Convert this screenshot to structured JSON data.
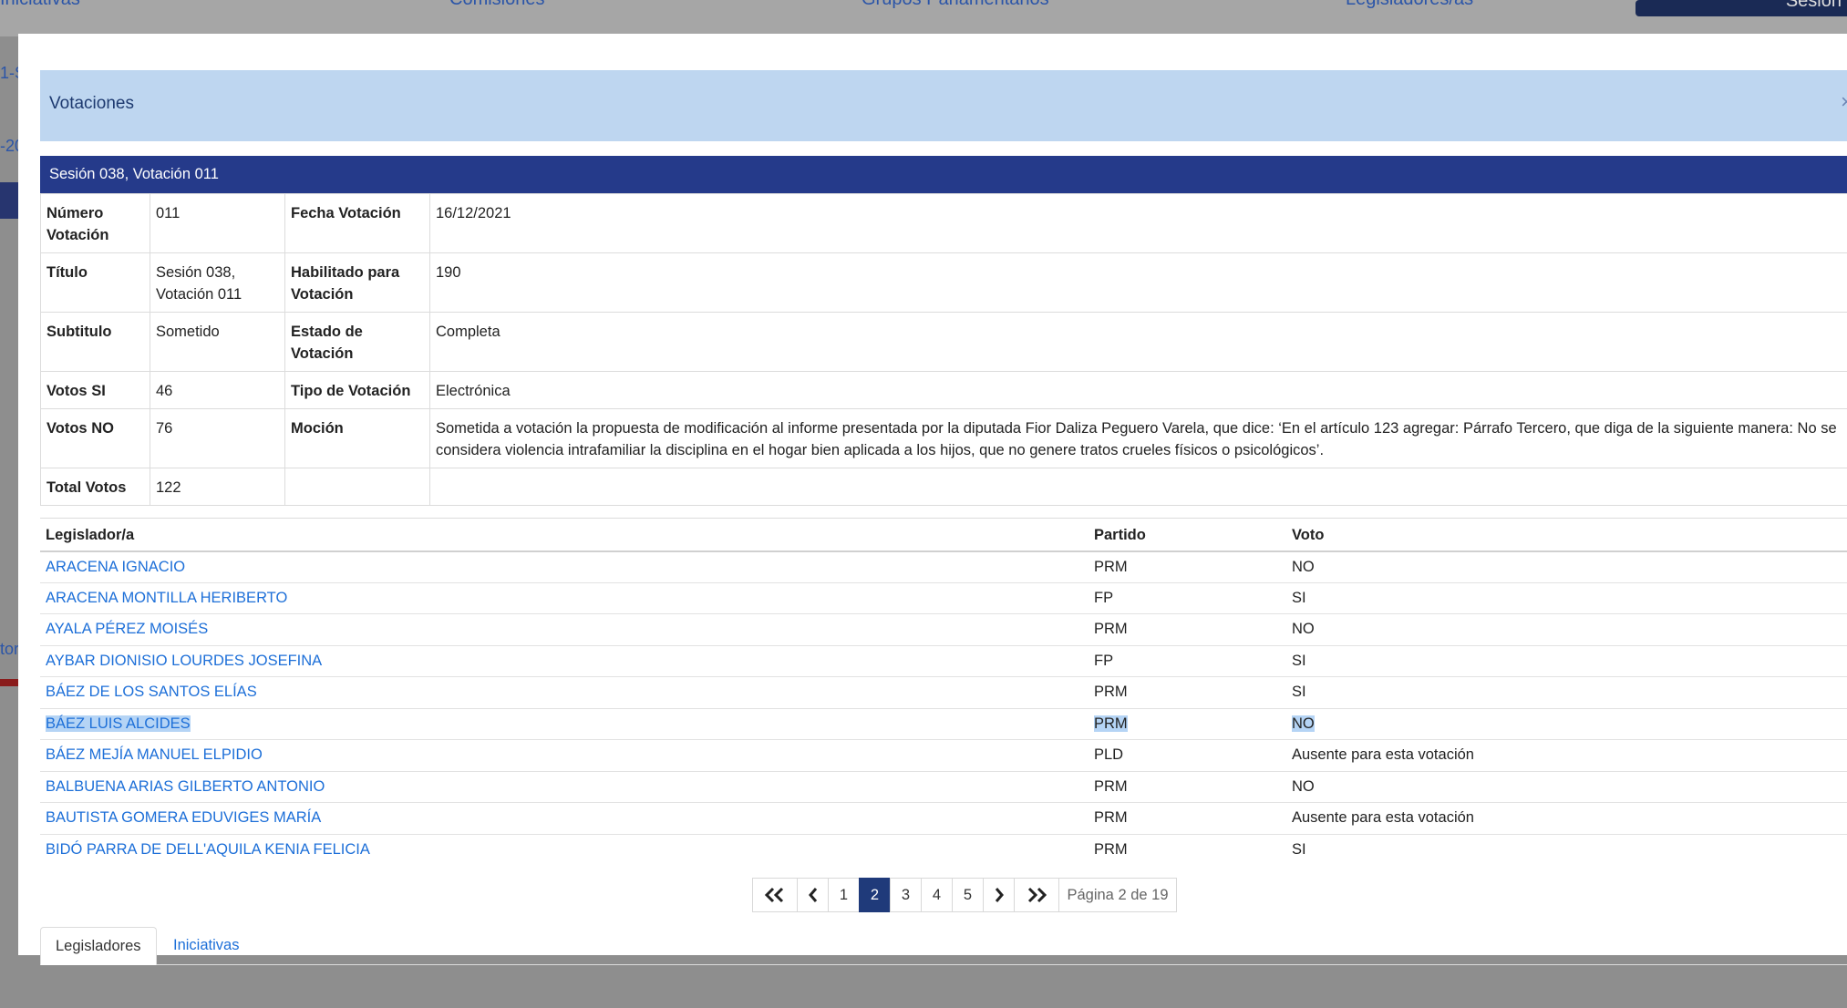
{
  "background": {
    "nav": [
      "Iniciativas",
      "Comisiones",
      "Grupos Parlamentarios",
      "Legisladores/as"
    ],
    "button": "Sesión",
    "left_fragments": [
      "1-S",
      "-20",
      "tori"
    ]
  },
  "modal": {
    "title": "Votaciones",
    "close": "×",
    "session_header": "Sesión 038, Votación 011",
    "info": {
      "numero_label": "Número Votación",
      "numero_value": "011",
      "fecha_label": "Fecha Votación",
      "fecha_value": "16/12/2021",
      "titulo_label": "Título",
      "titulo_value": "Sesión 038, Votación 011",
      "habilitado_label": "Habilitado para Votación",
      "habilitado_value": "190",
      "subtitulo_label": "Subtitulo",
      "subtitulo_value": "Sometido",
      "estado_label": "Estado de Votación",
      "estado_value": "Completa",
      "votos_si_label": "Votos SI",
      "votos_si_value": "46",
      "tipo_label": "Tipo de Votación",
      "tipo_value": "Electrónica",
      "votos_no_label": "Votos NO",
      "votos_no_value": "76",
      "mocion_label": "Moción",
      "mocion_value": "Sometida a votación la propuesta de modificación al informe presentada por la diputada Fior Daliza Peguero Varela, que dice: ‘En el artículo 123 agregar: Párrafo Tercero, que diga de la siguiente manera: No se considera violencia intrafamiliar la disciplina en el hogar bien aplicada a los hijos, que no genere tratos crueles físicos o psicológicos’.",
      "total_label": "Total Votos",
      "total_value": "122"
    },
    "legislators": {
      "headers": [
        "Legislador/a",
        "Partido",
        "Voto"
      ],
      "rows": [
        {
          "name": "ARACENA IGNACIO",
          "party": "PRM",
          "vote": "NO"
        },
        {
          "name": "ARACENA MONTILLA HERIBERTO",
          "party": "FP",
          "vote": "SI"
        },
        {
          "name": "AYALA PÉREZ MOISÉS",
          "party": "PRM",
          "vote": "NO"
        },
        {
          "name": "AYBAR DIONISIO LOURDES JOSEFINA",
          "party": "FP",
          "vote": "SI"
        },
        {
          "name": "BÁEZ DE LOS SANTOS ELÍAS",
          "party": "PRM",
          "vote": "SI"
        },
        {
          "name": "BÁEZ LUIS ALCIDES",
          "party": "PRM",
          "vote": "NO"
        },
        {
          "name": "BÁEZ MEJÍA MANUEL ELPIDIO",
          "party": "PLD",
          "vote": "Ausente para esta votación"
        },
        {
          "name": "BALBUENA ARIAS GILBERTO ANTONIO",
          "party": "PRM",
          "vote": "NO"
        },
        {
          "name": "BAUTISTA GOMERA EDUVIGES MARÍA",
          "party": "PRM",
          "vote": "Ausente para esta votación"
        },
        {
          "name": "BIDÓ PARRA DE DELL'AQUILA KENIA FELICIA",
          "party": "PRM",
          "vote": "SI"
        }
      ]
    },
    "pagination": {
      "first": "«",
      "prev": "‹",
      "pages": [
        "1",
        "2",
        "3",
        "4",
        "5"
      ],
      "active_page": "2",
      "next": "›",
      "last": "»",
      "info": "Página 2 de 19"
    },
    "tabs": [
      "Legisladores",
      "Iniciativas"
    ]
  }
}
